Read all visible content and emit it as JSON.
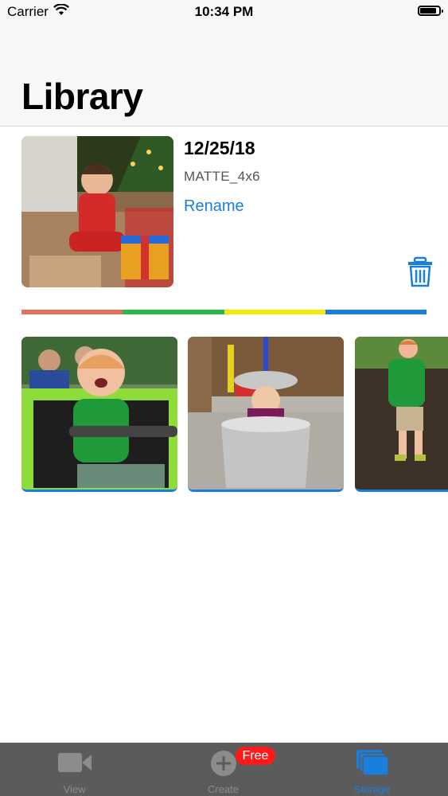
{
  "status_bar": {
    "carrier": "Carrier",
    "time": "10:34 PM"
  },
  "header": {
    "title": "Library"
  },
  "card": {
    "date": "12/25/18",
    "format": "MATTE_4x6",
    "rename_label": "Rename",
    "delete_icon": "trash-icon",
    "color_bar": [
      "#e07060",
      "#2db84a",
      "#f5e80a",
      "#1a7fdc"
    ]
  },
  "photos": [
    {
      "icon": "photo-kid-in-green-car"
    },
    {
      "icon": "photo-kid-in-trash-can"
    },
    {
      "icon": "photo-kid-in-dirt"
    }
  ],
  "tab_bar": {
    "tabs": [
      {
        "label": "View",
        "icon": "video-camera-icon",
        "active": false
      },
      {
        "label": "Create",
        "icon": "plus-circle-icon",
        "active": false,
        "badge": "Free"
      },
      {
        "label": "Storage",
        "icon": "stacked-folders-icon",
        "active": true
      }
    ]
  },
  "colors": {
    "accent": "#1a7fdc",
    "badge": "#ff1a1a",
    "tab_bar_bg": "#5b5b5b"
  }
}
